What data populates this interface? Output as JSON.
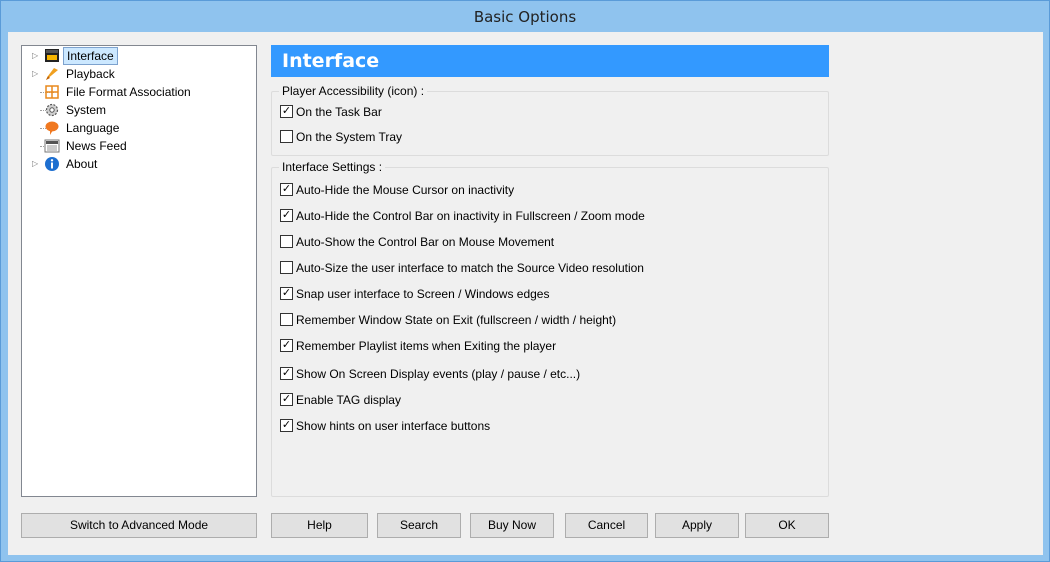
{
  "window": {
    "title": "Basic Options"
  },
  "tree": {
    "items": [
      {
        "label": "Interface",
        "selected": true,
        "expandable": true,
        "icon": "monitor-icon"
      },
      {
        "label": "Playback",
        "selected": false,
        "expandable": true,
        "icon": "play-arrow-icon"
      },
      {
        "label": "File Format Association",
        "selected": false,
        "expandable": false,
        "icon": "file-association-icon"
      },
      {
        "label": "System",
        "selected": false,
        "expandable": false,
        "icon": "gear-icon"
      },
      {
        "label": "Language",
        "selected": false,
        "expandable": false,
        "icon": "speech-bubble-icon"
      },
      {
        "label": "News Feed",
        "selected": false,
        "expandable": false,
        "icon": "news-icon"
      },
      {
        "label": "About",
        "selected": false,
        "expandable": true,
        "icon": "info-icon"
      }
    ]
  },
  "panel": {
    "title": "Interface",
    "accessibility": {
      "title": "Player Accessibility (icon) :",
      "options": [
        {
          "label": "On the Task Bar",
          "checked": true
        },
        {
          "label": "On the System Tray",
          "checked": false
        }
      ]
    },
    "settings": {
      "title": "Interface Settings :",
      "options": [
        {
          "label": "Auto-Hide the Mouse Cursor on inactivity",
          "checked": true
        },
        {
          "label": "Auto-Hide the Control Bar on inactivity in Fullscreen / Zoom mode",
          "checked": true
        },
        {
          "label": "Auto-Show the Control Bar on Mouse Movement",
          "checked": false
        },
        {
          "label": "Auto-Size the user interface to match the Source Video resolution",
          "checked": false
        },
        {
          "label": "Snap user interface to Screen / Windows edges",
          "checked": true
        },
        {
          "label": "Remember Window State on Exit (fullscreen / width / height)",
          "checked": false
        },
        {
          "label": "Remember Playlist items when Exiting the player",
          "checked": true
        },
        {
          "label": "Show On Screen Display events (play / pause / etc...)",
          "checked": true
        },
        {
          "label": "Enable TAG display",
          "checked": true
        },
        {
          "label": "Show hints on user interface buttons",
          "checked": true
        }
      ]
    }
  },
  "buttons": {
    "advanced": "Switch to Advanced Mode",
    "help": "Help",
    "search": "Search",
    "buy": "Buy Now",
    "cancel": "Cancel",
    "apply": "Apply",
    "ok": "OK"
  },
  "colors": {
    "header": "#3399ff",
    "titlebar": "#8fc3ee",
    "selection": "#cce8ff"
  }
}
